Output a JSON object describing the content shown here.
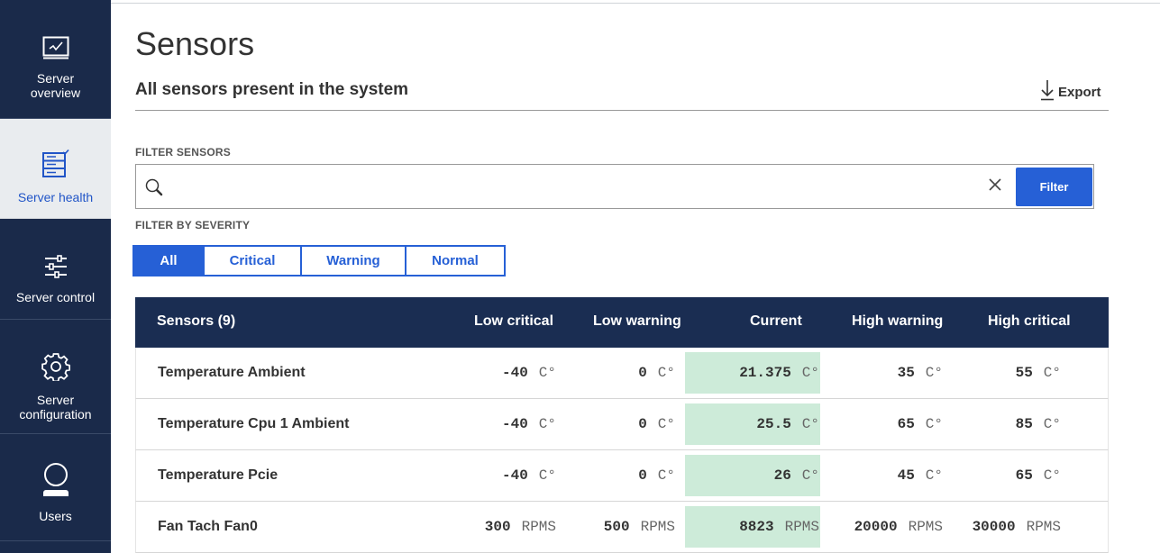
{
  "sidebar": {
    "items": [
      {
        "label": "Server overview",
        "icon": "monitor-chart-icon"
      },
      {
        "label": "Server health",
        "icon": "server-health-icon"
      },
      {
        "label": "Server control",
        "icon": "sliders-icon"
      },
      {
        "label": "Server configuration",
        "icon": "gear-icon"
      },
      {
        "label": "Users",
        "icon": "user-icon"
      }
    ]
  },
  "page": {
    "title": "Sensors",
    "subtitle": "All sensors present in the system",
    "export_label": "Export"
  },
  "filter": {
    "label": "FILTER SENSORS",
    "value": "",
    "placeholder": "",
    "button_label": "Filter"
  },
  "severity": {
    "label": "FILTER BY SEVERITY",
    "options": [
      "All",
      "Critical",
      "Warning",
      "Normal"
    ],
    "selected": "All"
  },
  "table": {
    "headers": [
      "Sensors (9)",
      "Low critical",
      "Low warning",
      "Current",
      "High warning",
      "High critical"
    ],
    "rows": [
      {
        "name": "Temperature Ambient",
        "low_critical": "-40",
        "low_warning": "0",
        "current": "21.375",
        "high_warning": "35",
        "high_critical": "55",
        "unit": "C°",
        "status": "normal"
      },
      {
        "name": "Temperature Cpu 1 Ambient",
        "low_critical": "-40",
        "low_warning": "0",
        "current": "25.5",
        "high_warning": "65",
        "high_critical": "85",
        "unit": "C°",
        "status": "normal"
      },
      {
        "name": "Temperature Pcie",
        "low_critical": "-40",
        "low_warning": "0",
        "current": "26",
        "high_warning": "45",
        "high_critical": "65",
        "unit": "C°",
        "status": "normal"
      },
      {
        "name": "Fan Tach Fan0",
        "low_critical": "300",
        "low_warning": "500",
        "current": "8823",
        "high_warning": "20000",
        "high_critical": "30000",
        "unit": "RPMS",
        "status": "normal"
      }
    ]
  },
  "colors": {
    "sidebar_bg": "#1a2a4a",
    "accent": "#2660d6",
    "header_bg": "#1a2d52",
    "normal_status": "#cdebd9"
  }
}
